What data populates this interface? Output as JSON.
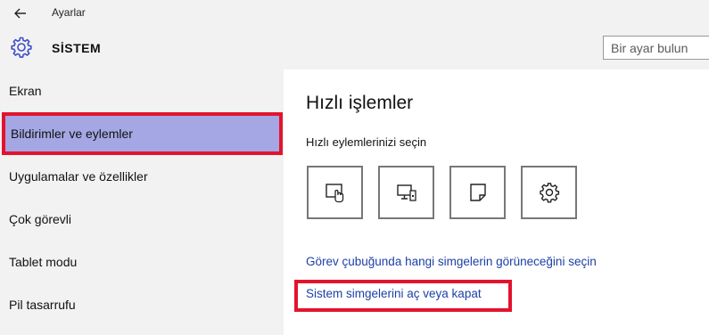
{
  "window": {
    "title": "Ayarlar"
  },
  "header": {
    "section_title": "SİSTEM",
    "search_placeholder": "Bir ayar bulun"
  },
  "sidebar": {
    "items": [
      {
        "label": "Ekran",
        "selected": false
      },
      {
        "label": "Bildirimler ve eylemler",
        "selected": true
      },
      {
        "label": "Uygulamalar ve özellikler",
        "selected": false
      },
      {
        "label": "Çok görevli",
        "selected": false
      },
      {
        "label": "Tablet modu",
        "selected": false
      },
      {
        "label": "Pil tasarrufu",
        "selected": false
      }
    ]
  },
  "main": {
    "title": "Hızlı işlemler",
    "subtitle": "Hızlı eylemlerinizi seçin",
    "quick_actions": [
      {
        "icon": "tablet-mode-icon"
      },
      {
        "icon": "connect-display-icon"
      },
      {
        "icon": "note-icon"
      },
      {
        "icon": "settings-gear-icon"
      }
    ],
    "links": {
      "taskbar_icons": "Görev çubuğunda hangi simgelerin görüneceğini seçin",
      "system_icons": "Sistem simgelerini aç veya kapat"
    }
  },
  "colors": {
    "selected_bg": "#a4a7e3",
    "highlight_border": "#e2142d",
    "link": "#1d3fa6"
  }
}
